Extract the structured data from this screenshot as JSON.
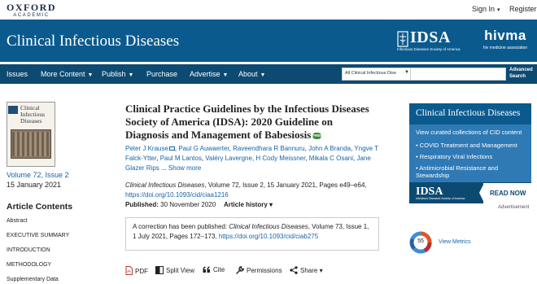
{
  "header": {
    "publisher_line1": "OXFORD",
    "publisher_line2": "ACADEMIC",
    "signin": "Sign In",
    "register": "Register"
  },
  "banner": {
    "journal": "Clinical Infectious Diseases",
    "idsa": "IDSA",
    "idsa_sub": "Infectious Diseases Society of America",
    "hivma": "hivma",
    "hivma_sub": "hiv medicine association"
  },
  "nav": {
    "items": [
      "Issues",
      "More Content",
      "Publish",
      "Purchase",
      "Advertise",
      "About"
    ],
    "search_scope": "All Clinical Infectious Dise",
    "search_placeholder": "",
    "advanced_line1": "Advanced",
    "advanced_line2": "Search"
  },
  "issue": {
    "cover_title": "Clinical Infectious Diseases",
    "volume": "Volume 72, Issue 2",
    "date": "15 January 2021"
  },
  "contents": {
    "heading": "Article Contents",
    "items": [
      "Abstract",
      "EXECUTIVE SUMMARY",
      "INTRODUCTION",
      "METHODOLOGY",
      "Supplementary Data"
    ]
  },
  "article": {
    "title": "Clinical Practice Guidelines by the Infectious Diseases Society of America (IDSA): 2020 Guideline on Diagnosis and Management of Babesiosis",
    "free_badge": "FREE",
    "authors": [
      "Peter J Krause",
      "Paul G Auwaerter",
      "Raveendhara R Bannuru",
      "John A Branda",
      "Yngve T Falck-Ytter",
      "Paul M Lantos",
      "Valéry Lavergne",
      "H Cody Meissner",
      "Mikala C Osani",
      "Jane Glazer Rips"
    ],
    "show_more": "Show more",
    "citation_journal": "Clinical Infectious Diseases",
    "citation_rest": ", Volume 72, Issue 2, 15 January 2021, Pages e49–e64,",
    "doi": "https://doi.org/10.1093/cid/ciaa1216",
    "published_label": "Published:",
    "published_date": "30 November 2020",
    "history": "Article history"
  },
  "correction": {
    "prefix": "A correction has been published: ",
    "journal": "Clinical Infectious Diseases",
    "rest": ", Volume 73, Issue 1, 1 July 2021, Pages 172–173, ",
    "doi": "https://doi.org/10.1093/cid/ciab275"
  },
  "tools": {
    "pdf": "PDF",
    "split": "Split View",
    "cite": "Cite",
    "permissions": "Permissions",
    "share": "Share"
  },
  "promo": {
    "title": "Clinical Infectious Diseases",
    "intro": "View curated collections of CID content",
    "items": [
      "COVID Treatment and Management",
      "Respiratory Viral Infections",
      "Antimicrobial Resistance and Stewardship"
    ],
    "idsa": "IDSA",
    "idsa_sub": "Infectious Diseases Society of America",
    "cta": "READ NOW"
  },
  "advertisement_label": "Advertisement",
  "metrics": {
    "score": "55",
    "label": "View Metrics"
  },
  "colors": {
    "banner": "#0b5a8e",
    "nav": "#0d4a72",
    "link": "#1863a6",
    "promo": "#2f79b5"
  }
}
